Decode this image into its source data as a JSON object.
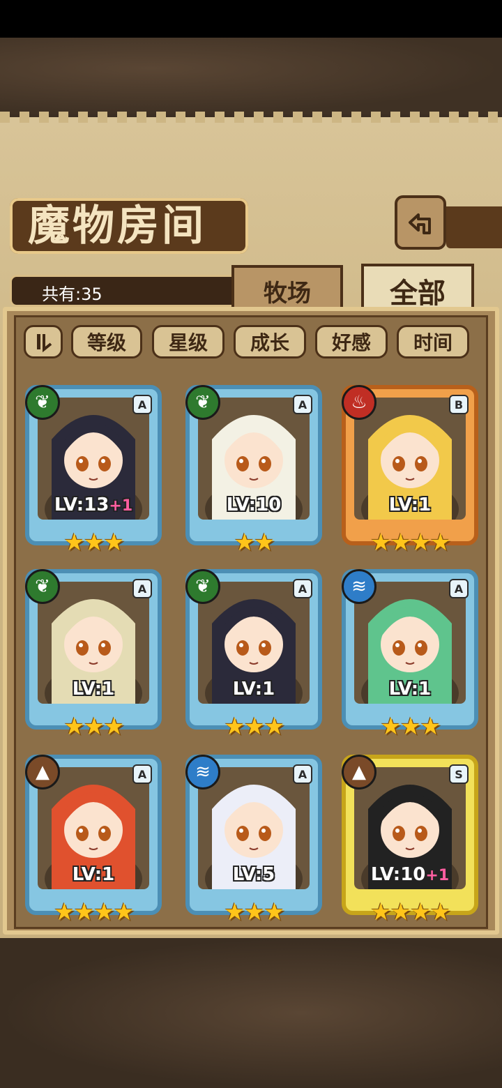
{
  "title": "魔物房间",
  "count_label": "共有:35",
  "tabs": {
    "ranch": "牧场",
    "all": "全部"
  },
  "sort_buttons": [
    "等级",
    "星级",
    "成长",
    "好感",
    "时间"
  ],
  "cards": [
    {
      "element": "grass",
      "rarity": "A",
      "level": "LV:13",
      "bonus": "+1",
      "stars": "★★★",
      "color": "blue",
      "hair": "#2b2a3a"
    },
    {
      "element": "grass",
      "rarity": "A",
      "level": "LV:10",
      "bonus": "",
      "stars": "★★",
      "color": "blue",
      "hair": "#f3f1e4"
    },
    {
      "element": "fire",
      "rarity": "B",
      "level": "LV:1",
      "bonus": "",
      "stars": "★★★★",
      "color": "orange",
      "hair": "#f2c94a"
    },
    {
      "element": "grass",
      "rarity": "A",
      "level": "LV:1",
      "bonus": "",
      "stars": "★★★",
      "color": "blue",
      "hair": "#e4dcb4"
    },
    {
      "element": "grass",
      "rarity": "A",
      "level": "LV:1",
      "bonus": "",
      "stars": "★★★",
      "color": "blue",
      "hair": "#2b2a3a"
    },
    {
      "element": "water",
      "rarity": "A",
      "level": "LV:1",
      "bonus": "",
      "stars": "★★★",
      "color": "blue",
      "hair": "#5fc48d"
    },
    {
      "element": "earth",
      "rarity": "A",
      "level": "LV:1",
      "bonus": "",
      "stars": "★★★★",
      "color": "blue",
      "hair": "#e0512e"
    },
    {
      "element": "water",
      "rarity": "A",
      "level": "LV:5",
      "bonus": "",
      "stars": "★★★",
      "color": "blue",
      "hair": "#eceef8"
    },
    {
      "element": "earth",
      "rarity": "S",
      "level": "LV:10",
      "bonus": "+1",
      "stars": "★★★★",
      "color": "gold",
      "hair": "#222222"
    }
  ]
}
